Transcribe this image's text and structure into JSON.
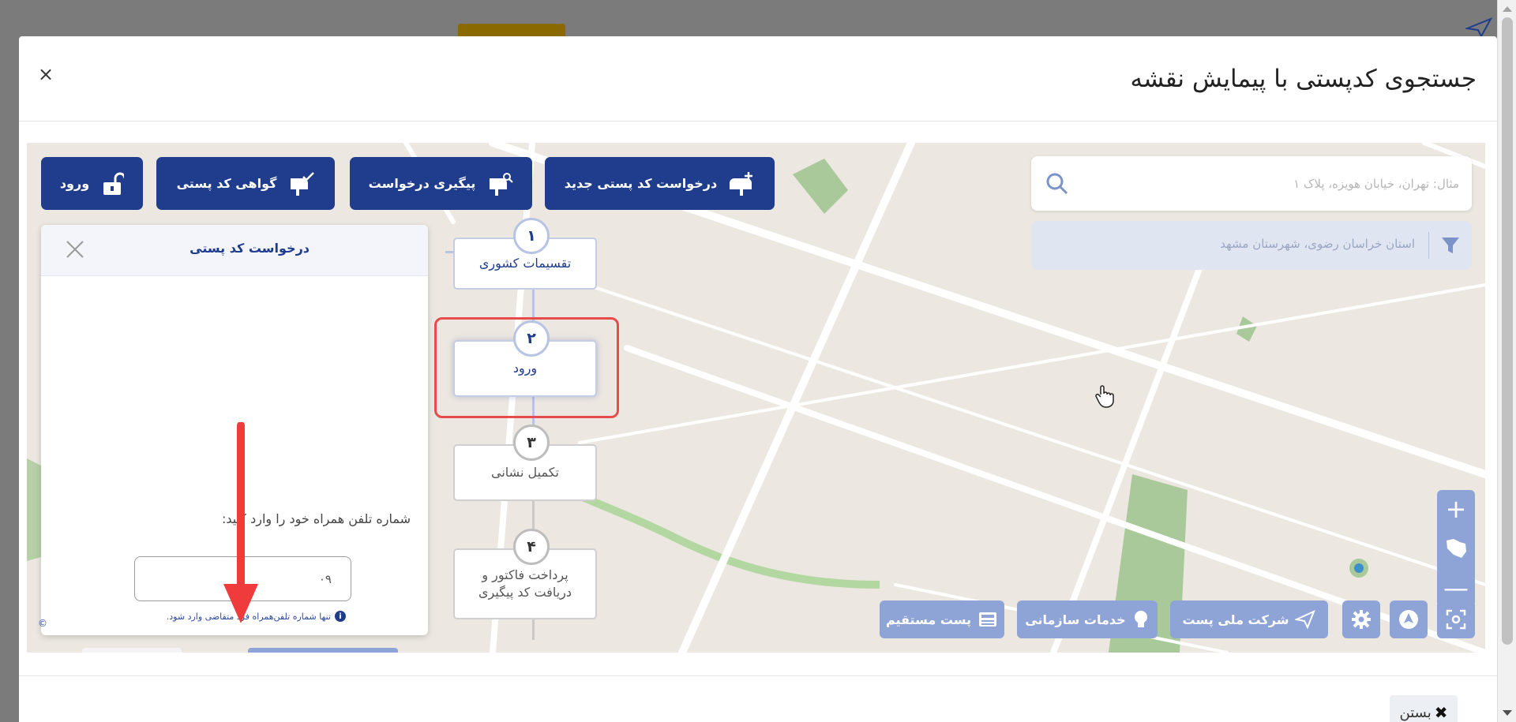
{
  "modal": {
    "title": "جستجوی کدپستی با پیمایش نقشه",
    "close_symbol": "×",
    "footer_close_label": "بستن",
    "footer_close_symbol": "✖"
  },
  "toolbar": {
    "new_request_label": "درخواست کد پستی جدید",
    "track_request_label": "پیگیری درخواست",
    "certificate_label": "گواهی کد پستی",
    "login_label": "ورود"
  },
  "search": {
    "placeholder": "مثال: تهران، خیابان هویزه، پلاک ۱",
    "value": ""
  },
  "filter": {
    "text": "استان خراسان رضوی، شهرستان مشهد"
  },
  "panel": {
    "title": "درخواست کد پستی",
    "phone_label": "شماره تلفن همراه خود را وارد کنید:",
    "phone_value": "۰۹",
    "phone_hint": "تنها شماره تلفن‌همراه فرد متقاضی وارد شود.",
    "info_symbol": "i"
  },
  "steps": [
    {
      "number": "۱",
      "label": "تقسیمات کشوری",
      "state": "done"
    },
    {
      "number": "۲",
      "label": "ورود",
      "state": "active"
    },
    {
      "number": "۳",
      "label": "تکمیل نشانی",
      "state": "pending"
    },
    {
      "number": "۴",
      "label": "پرداخت فاکتور و دریافت کد پیگیری",
      "state": "pending"
    }
  ],
  "map_controls": {
    "zoom_in_symbol": "+",
    "zoom_out_symbol": "—",
    "national_post_label": "شرکت ملی پست",
    "org_services_label": "خدمات سازمانی",
    "direct_post_label": "پست مستقیم"
  },
  "attribution_symbol": "©",
  "colors": {
    "primary": "#1f3d8c",
    "secondary": "#8fa4d6",
    "highlight": "#e74c4c",
    "map_bg": "#ece7e1"
  },
  "icons": [
    "close-icon",
    "mailbox-plus-icon",
    "mailbox-search-icon",
    "mailbox-check-icon",
    "unlock-icon",
    "search-icon",
    "filter-icon",
    "red-arrow",
    "iran-map-icon",
    "gear-icon",
    "north-arrow-icon",
    "locate-icon",
    "paper-plane-icon",
    "bulb-icon",
    "newspaper-icon",
    "info-icon",
    "pointer-hand-icon"
  ]
}
